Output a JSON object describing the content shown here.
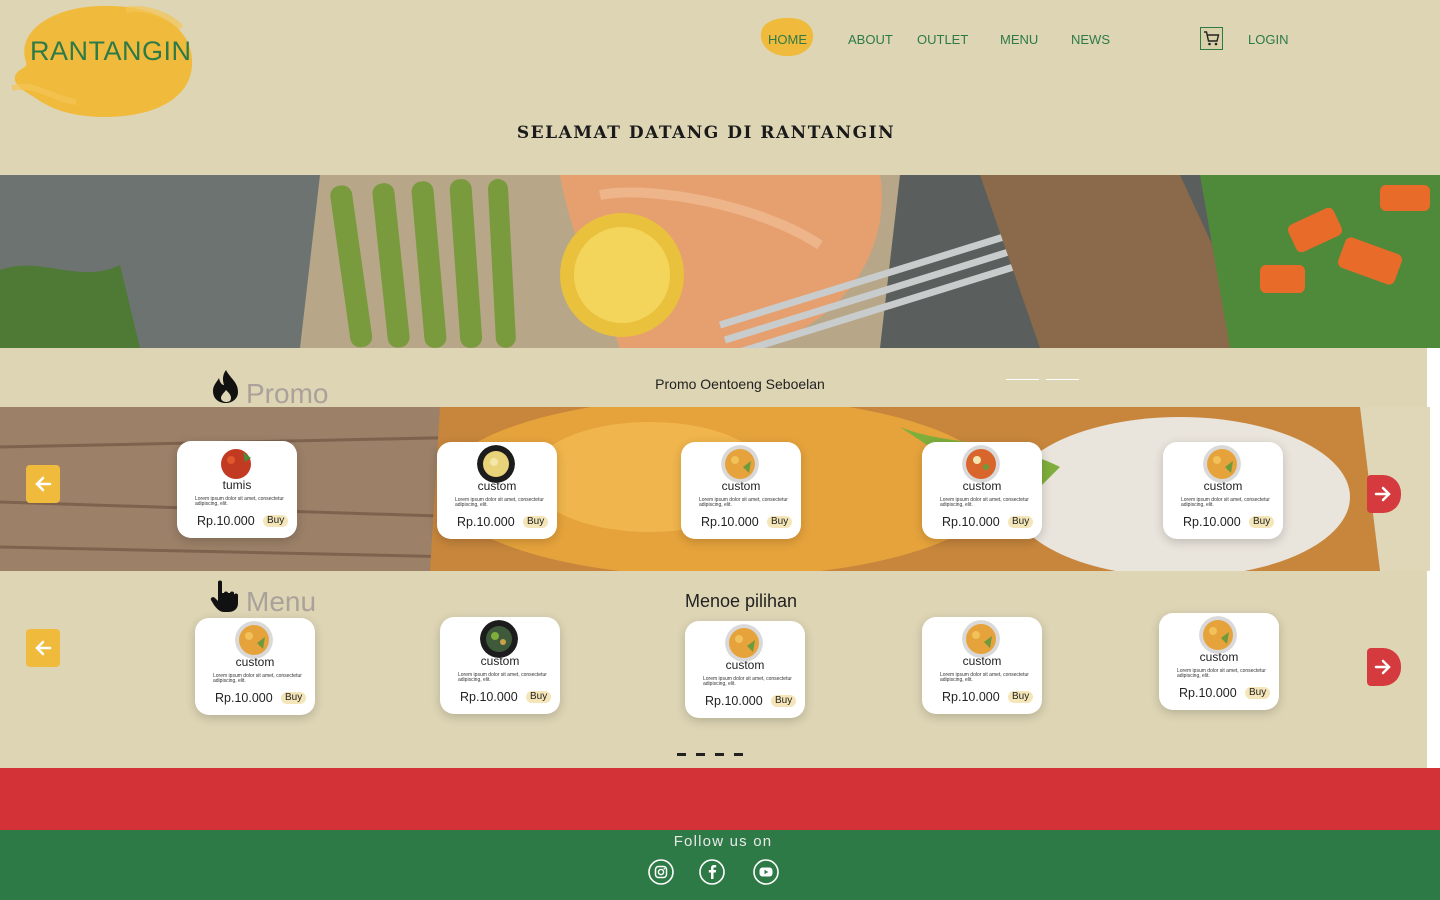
{
  "header": {
    "logo": "RANTANGIN",
    "nav": [
      "HOME",
      "ABOUT",
      "OUTLET",
      "MENU",
      "NEWS"
    ],
    "login": "LOGIN",
    "cart_icon": "shopping-cart-icon",
    "welcome": "SELAMAT DATANG DI RANTANGIN"
  },
  "promo": {
    "title": "Promo",
    "subtitle": "Promo Oentoeng Seboelan",
    "cards": [
      {
        "name": "tumis",
        "desc": "Lorem ipsum dolor sit amet, consectetur adipiscing, elit.",
        "price": "Rp.10.000",
        "buy": "Buy"
      },
      {
        "name": "custom",
        "desc": "Lorem ipsum dolor sit amet, consectetur adipiscing, elit.",
        "price": "Rp.10.000",
        "buy": "Buy"
      },
      {
        "name": "custom",
        "desc": "Lorem ipsum dolor sit amet, consectetur adipiscing, elit.",
        "price": "Rp.10.000",
        "buy": "Buy"
      },
      {
        "name": "custom",
        "desc": "Lorem ipsum dolor sit amet, consectetur adipiscing, elit.",
        "price": "Rp.10.000",
        "buy": "Buy"
      },
      {
        "name": "custom",
        "desc": "Lorem ipsum dolor sit amet, consectetur adipiscing, elit.",
        "price": "Rp.10.000",
        "buy": "Buy"
      }
    ]
  },
  "menu": {
    "title": "Menu",
    "subtitle": "Menoe pilihan",
    "cards": [
      {
        "name": "custom",
        "desc": "Lorem ipsum dolor sit amet, consectetur adipiscing, elit.",
        "price": "Rp.10.000",
        "buy": "Buy"
      },
      {
        "name": "custom",
        "desc": "Lorem ipsum dolor sit amet, consectetur adipiscing, elit.",
        "price": "Rp.10.000",
        "buy": "Buy"
      },
      {
        "name": "custom",
        "desc": "Lorem ipsum dolor sit amet, consectetur adipiscing, elit.",
        "price": "Rp.10.000",
        "buy": "Buy"
      },
      {
        "name": "custom",
        "desc": "Lorem ipsum dolor sit amet, consectetur adipiscing, elit.",
        "price": "Rp.10.000",
        "buy": "Buy"
      },
      {
        "name": "custom",
        "desc": "Lorem ipsum dolor sit amet, consectetur adipiscing, elit.",
        "price": "Rp.10.000",
        "buy": "Buy"
      }
    ]
  },
  "footer": {
    "follow": "Follow us on",
    "icons": [
      "instagram-icon",
      "facebook-icon",
      "youtube-icon"
    ]
  },
  "colors": {
    "background": "#ddd5b4",
    "brand_green": "#2e7a47",
    "accent_yellow": "#f0bb3c",
    "accent_red": "#d33237"
  }
}
